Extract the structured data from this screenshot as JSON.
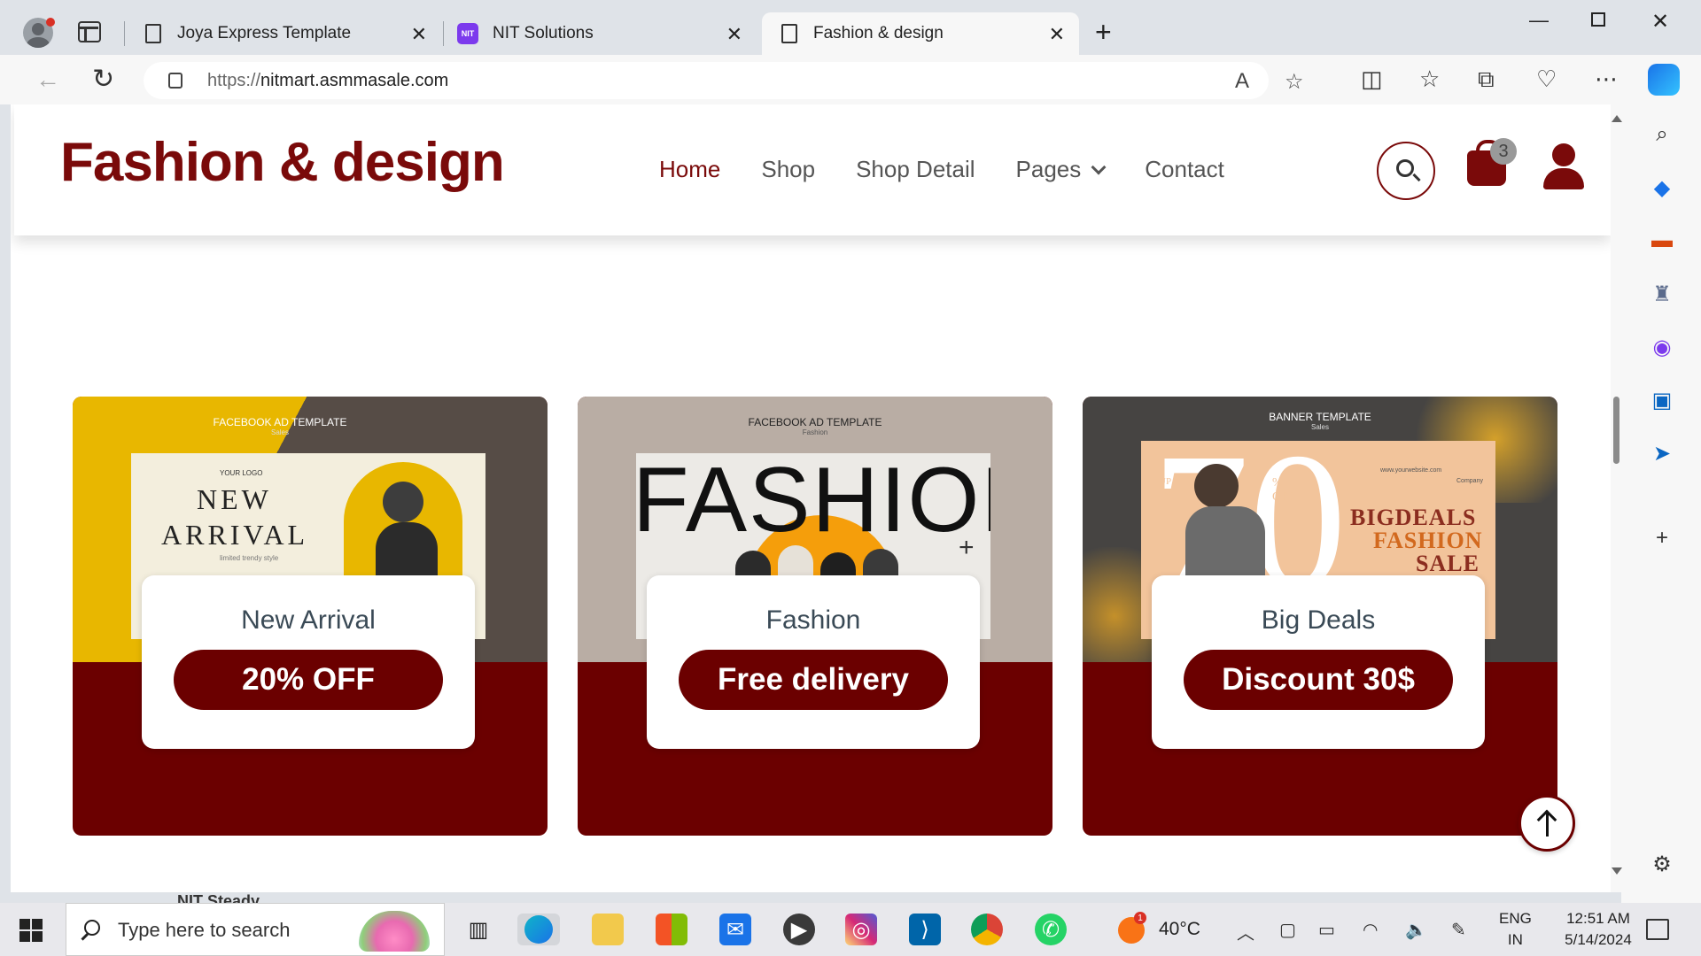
{
  "tabs": [
    {
      "title": "Joya Express Template"
    },
    {
      "title": "NIT Solutions"
    },
    {
      "title": "Fashion & design"
    }
  ],
  "address": {
    "protocol": "https://",
    "host": "nitmart.asmmasale.com"
  },
  "site": {
    "brand": "Fashion & design",
    "menu": [
      {
        "label": "Home"
      },
      {
        "label": "Shop"
      },
      {
        "label": "Shop Detail"
      },
      {
        "label": "Pages"
      },
      {
        "label": "Contact"
      }
    ],
    "cart_count": "3"
  },
  "promos": [
    {
      "title": "New Arrival",
      "button": "20% OFF",
      "ad_header": "FACEBOOK AD TEMPLATE",
      "ad_sub": "Sales",
      "ad_logo": "YOUR LOGO",
      "ad_line1": "NEW",
      "ad_line2": "ARRIVAL",
      "ad_tag": "limited trendy style"
    },
    {
      "title": "Fashion",
      "button": "Free delivery",
      "ad_header": "FACEBOOK AD TEMPLATE",
      "ad_sub": "Fashion",
      "ad_big": "FASHION"
    },
    {
      "title": "Big Deals",
      "button": "Discount 30$",
      "ad_header": "BANNER TEMPLATE",
      "ad_sub": "Sales",
      "ad_num": "70",
      "ad_upto": "UP TO",
      "ad_pct": "% OFF",
      "ad_url": "www.yourwebsite.com",
      "ad_company": "Company",
      "ad_l1": "BIGDEALS",
      "ad_l2": "FASHION",
      "ad_l3": "SALE"
    }
  ],
  "taskbar": {
    "search_placeholder": "Type here to search",
    "weather_badge": "1",
    "temperature": "40°C",
    "lang_top": "ENG",
    "lang_bottom": "IN",
    "time": "12:51 AM",
    "date": "5/14/2024"
  },
  "peek_text": "NIT Steady",
  "colors": {
    "brand": "#7a0a0a",
    "card_bg": "#6b0000",
    "accent_yellow": "#e8b700"
  }
}
